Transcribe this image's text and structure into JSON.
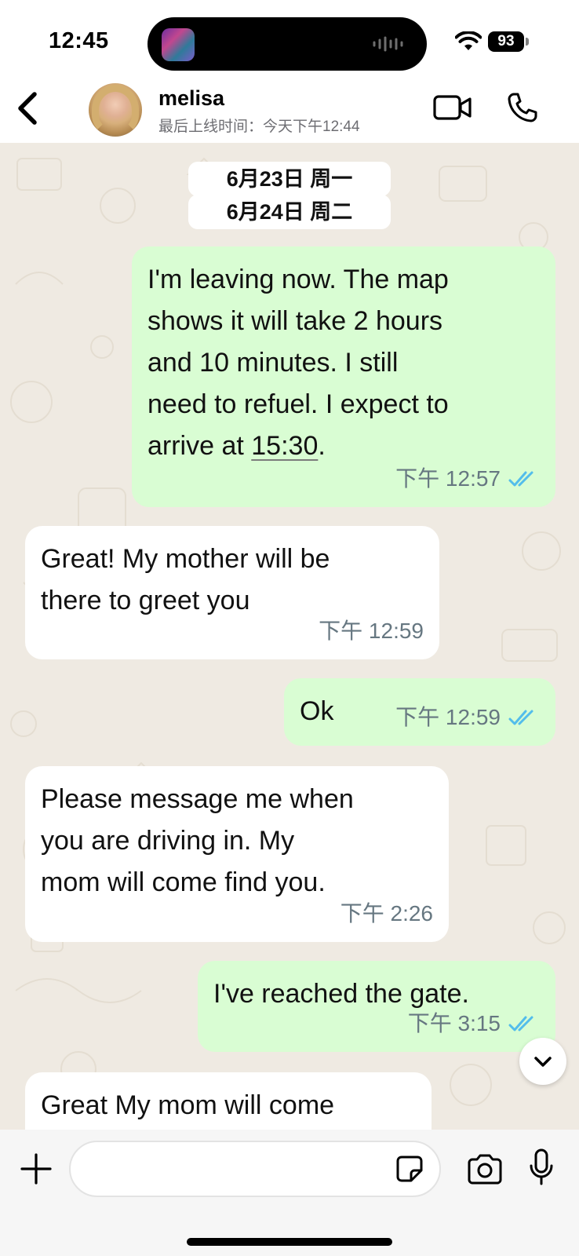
{
  "status_bar": {
    "time": "12:45",
    "battery": "93"
  },
  "header": {
    "contact_name": "melisa",
    "last_seen": "最后上线时间：今天下午12:44"
  },
  "date_dividers": [
    "6月23日 周一",
    "6月24日 周二"
  ],
  "messages": [
    {
      "direction": "out",
      "text": "I'm leaving now. The map\nshows it will take 2 hours\nand 10 minutes. I still\nneed to refuel. I expect to\narrive at ",
      "text_link": "15:30",
      "text_after": ".",
      "time": "下午 12:57",
      "status": "read"
    },
    {
      "direction": "in",
      "text": "Great!  My mother will be\nthere to greet you",
      "time": "下午 12:59"
    },
    {
      "direction": "out",
      "text": "Ok",
      "time": "下午 12:59",
      "status": "read"
    },
    {
      "direction": "in",
      "text": "Please message me when\nyou are driving in.  My\nmom will come find you.",
      "time": "下午 2:26"
    },
    {
      "direction": "out",
      "text": "I've reached the gate.",
      "time": "下午 3:15",
      "status": "read"
    },
    {
      "direction": "in",
      "text": "Great  My mom will come",
      "time": ""
    }
  ],
  "input": {
    "placeholder": ""
  },
  "colors": {
    "outgoing_bubble": "#d9fdd3",
    "incoming_bubble": "#ffffff",
    "chat_background": "#efeae2",
    "read_ticks": "#53bdeb"
  },
  "icons": [
    "back-icon",
    "video-call-icon",
    "phone-call-icon",
    "plus-icon",
    "sticker-icon",
    "camera-icon",
    "microphone-icon",
    "chevron-down-icon",
    "double-check-icon",
    "wifi-icon"
  ]
}
